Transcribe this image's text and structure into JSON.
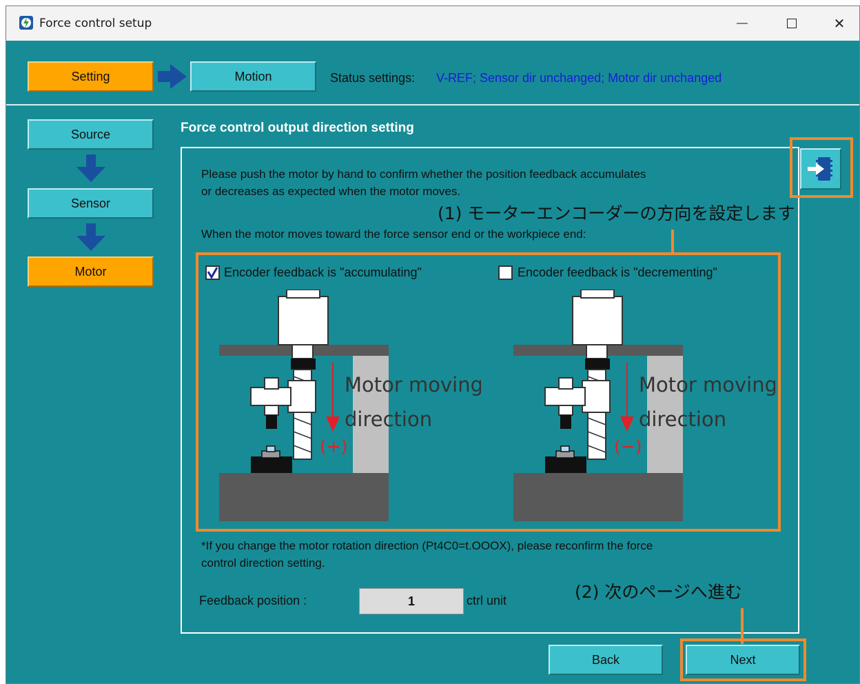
{
  "window": {
    "title": "Force control setup",
    "minimize_glyph": "—",
    "close_glyph": "✕"
  },
  "steps": {
    "setting": "Setting",
    "motion": "Motion"
  },
  "status": {
    "label": "Status settings:",
    "value": "V-REF; Sensor dir unchanged; Motor dir unchanged"
  },
  "sidebar": {
    "items": [
      {
        "label": "Source",
        "active": false
      },
      {
        "label": "Sensor",
        "active": false
      },
      {
        "label": "Motor",
        "active": true
      }
    ]
  },
  "main": {
    "section_title": "Force control output direction setting",
    "instruction_line1": "Please push the motor by hand to confirm whether the position feedback accumulates",
    "instruction_line2": "or decreases as expected when the motor moves.",
    "condition_text": "When the motor moves toward the force sensor end or the workpiece end:",
    "option_accumulating": {
      "label": "Encoder feedback is \"accumulating\"",
      "checked": true
    },
    "option_decrementing": {
      "label": "Encoder feedback is \"decrementing\"",
      "checked": false
    },
    "diagram_left": {
      "caption_line1": "Motor moving",
      "caption_line2": "direction",
      "sign": "(+)"
    },
    "diagram_right": {
      "caption_line1": "Motor moving",
      "caption_line2": "direction",
      "sign": "(−)"
    },
    "note_line1": "*If you change the motor rotation direction (Pt4C0=t.OOOX), please reconfirm the force",
    "note_line2": "control direction setting.",
    "feedback_label": "Feedback position :",
    "feedback_value": "1",
    "feedback_unit": "ctrl unit"
  },
  "footer": {
    "back_label": "Back",
    "next_label": "Next"
  },
  "annotations": {
    "note1": "(1) モーターエンコーダーの方向を設定します",
    "note2": "(2) 次のページへ進む"
  },
  "colors": {
    "background": "#178c96",
    "active_step": "#ffa500",
    "inactive_step": "#3cc0cc",
    "status_value": "#1b1bdc",
    "annotation": "#f08a2e",
    "direction_arrow": "#e32026"
  },
  "icons": {
    "app": "app-logo-icon",
    "export": "export-to-device-icon",
    "step_arrow": "arrow-right-icon",
    "sidebar_arrow": "arrow-down-icon"
  }
}
